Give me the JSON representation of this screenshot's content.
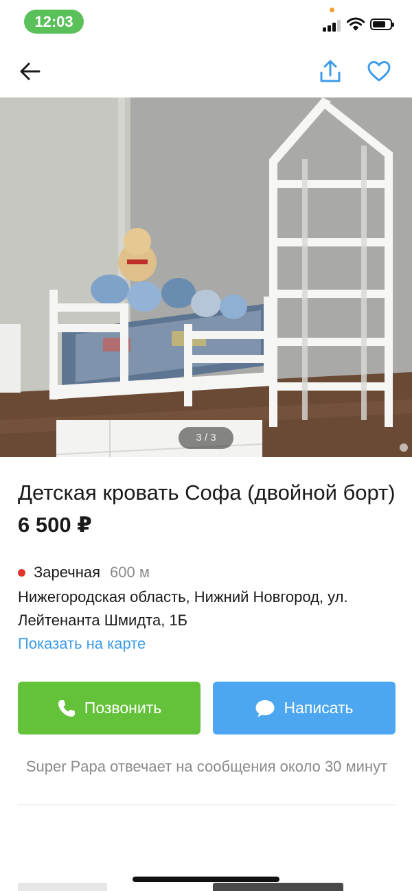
{
  "status_bar": {
    "time": "12:03",
    "signal_icon": "cellular-signal-icon",
    "wifi_icon": "wifi-icon",
    "battery_icon": "battery-icon",
    "battery_level": 0.75
  },
  "nav": {
    "back_icon": "arrow-left-icon",
    "share_icon": "share-upload-icon",
    "favorite_icon": "heart-outline-icon",
    "accent_color": "#3d9be9"
  },
  "gallery": {
    "counter": "3 / 3",
    "current": 3,
    "total": 3
  },
  "listing": {
    "title": "Детская кровать Софа (двойной борт)",
    "price": "6 500 ₽"
  },
  "location": {
    "metro_station": "Заречная",
    "metro_distance": "600 м",
    "metro_color": "#e0332b",
    "address": "Нижегородская область, Нижний Новгород, ул. Лейтенанта Шмидта, 1Б",
    "map_link": "Показать на карте"
  },
  "actions": {
    "call_label": "Позвонить",
    "call_icon": "phone-icon",
    "call_color": "#64c23a",
    "message_label": "Написать",
    "message_icon": "chat-bubble-icon",
    "message_color": "#4ca7f0"
  },
  "seller": {
    "response_note": "Super Papa отвечает на сообщения около 30 минут"
  }
}
